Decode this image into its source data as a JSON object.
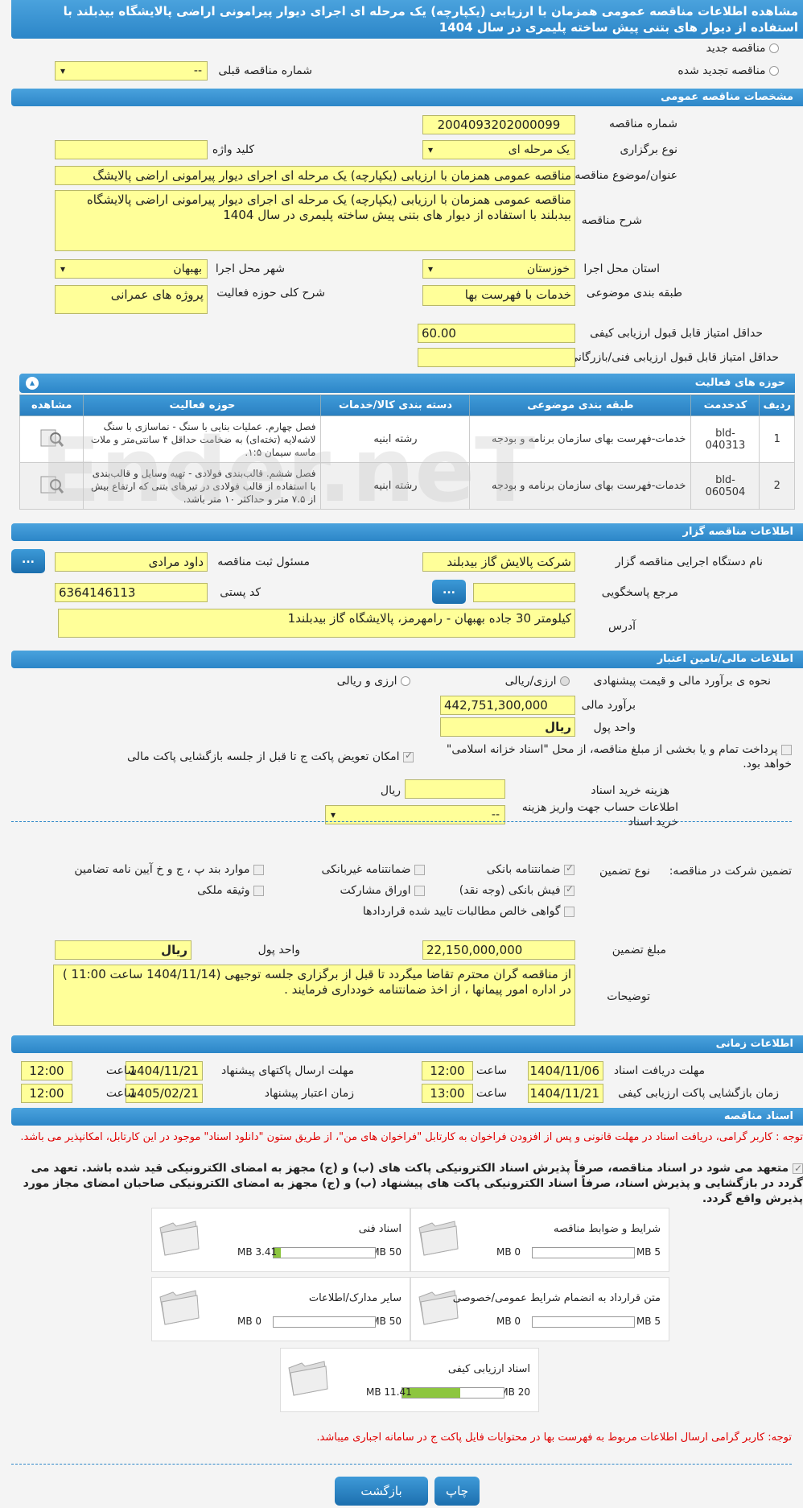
{
  "page": {
    "title": "مشاهده اطلاعات مناقصه عمومی همزمان با ارزیابی (یکپارچه) یک مرحله ای اجرای دیوار پیرامونی اراضی پالایشگاه بیدبلند با استفاده از دیوار های بتنی پیش ساخته پلیمری در سال 1404"
  },
  "top": {
    "new_tender": "مناقصه جدید",
    "renewed_tender": "مناقصه تجدید شده",
    "prev_number_label": "شماره مناقصه قبلی",
    "prev_number_value": "--"
  },
  "general": {
    "header": "مشخصات مناقصه عمومی",
    "number_label": "شماره مناقصه",
    "number_value": "2004093202000099",
    "type_label": "نوع برگزاری",
    "type_value": "یک مرحله ای",
    "keyword_label": "کلید واژه",
    "keyword_value": "",
    "subject_label": "عنوان/موضوع مناقصه",
    "subject_value": "مناقصه عمومی همزمان با ارزیابی (یکپارچه) یک مرحله ای اجرای دیوار پیرامونی اراضی پالایشگ",
    "desc_label": "شرح مناقصه",
    "desc_value": "مناقصه عمومی همزمان با ارزیابی (یکپارچه) یک مرحله ای اجرای دیوار پیرامونی اراضی پالایشگاه بیدبلند با استفاده از دیوار های بتنی پیش ساخته پلیمری در سال 1404",
    "province_label": "استان محل اجرا",
    "province_value": "خوزستان",
    "city_label": "شهر محل اجرا",
    "city_value": "بهبهان",
    "category_label": "طبقه بندی موضوعی",
    "category_value": "خدمات با فهرست بها",
    "scope_label": "شرح کلی حوزه فعالیت",
    "scope_value": "پروژه های عمرانی",
    "min_quality_label": "حداقل امتیاز قابل قبول ارزیابی کیفی",
    "min_quality_value": "60.00",
    "min_tech_label": "حداقل امتیاز قابل قبول ارزیابی فنی/بازرگانی",
    "min_tech_value": ""
  },
  "activities": {
    "header": "حوزه های فعالیت",
    "columns": [
      "ردیف",
      "کدخدمت",
      "طبقه بندی موضوعی",
      "دسته بندی کالا/خدمات",
      "حوزه فعالیت",
      "مشاهده"
    ],
    "rows": [
      {
        "row": "1",
        "code": "bld-040313",
        "category": "خدمات-فهرست بهای سازمان برنامه و بودجه",
        "group": "رشته ابنیه",
        "scope": "فصل چهارم. عملیات بنایی با سنگ - نماسازی با سنگ لاشه‌لایه (تخته‌ای) به ضخامت حداقل ۴ سانتی‌متر و ملات ماسه سیمان ۱:۵."
      },
      {
        "row": "2",
        "code": "bld-060504",
        "category": "خدمات-فهرست بهای سازمان برنامه و بودجه",
        "group": "رشته ابنیه",
        "scope": "فصل ششم. قالب‌بندی فولادی - تهیه وسایل و قالب‌بندی با استفاده از قالب فولادی در تیرهای بتنی که ارتفاع بیش از ۷.۵ متر و حداکثر ۱۰ متر باشد."
      }
    ]
  },
  "organizer": {
    "header": "اطلاعات مناقصه گزار",
    "org_label": "نام دستگاه اجرایی مناقصه گزار",
    "org_value": "شرکت پالایش گاز بیدبلند",
    "resp_label": "مسئول ثبت مناقصه",
    "resp_value": "داود مرادی",
    "ref_label": "مرجع پاسخگویی",
    "ref_value": "",
    "postal_label": "کد پستی",
    "postal_value": "6364146113",
    "address_label": "آدرس",
    "address_value": "کیلومتر 30 جاده بهبهان - رامهرمز، پالایشگاه گاز بیدبلند1",
    "more_btn": "..."
  },
  "finance": {
    "header": "اطلاعات مالی/تامین اعتبار",
    "estimate_method_label": "نحوه ی برآورد مالی و قیمت پیشنهادی",
    "opt_rial_fx": "ارزی/ریالی",
    "opt_fx_and_rial": "ارزی و ریالی",
    "estimate_label": "برآورد مالی",
    "estimate_value": "442,751,300,000",
    "currency_label": "واحد پول",
    "currency_value": "ریال",
    "treasury_text": "پرداخت تمام و یا بخشی از مبلغ مناقصه، از محل \"اسناد خزانه اسلامی\" خواهد بود.",
    "swap_text": "امکان تعویض پاکت ج تا قبل از جلسه بازگشایی پاکت مالی",
    "doc_fee_label": "هزینه خرید اسناد",
    "doc_fee_unit": "ریال",
    "account_label": "اطلاعات حساب جهت واریز هزینه خرید اسناد",
    "account_value": "--"
  },
  "guarantee": {
    "label": "تضمین شرکت در مناقصه:",
    "type_label": "نوع تضمین",
    "opt_bank_guarantee": "ضمانتنامه بانکی",
    "opt_nonbank_guarantee": "ضمانتنامه غیربانکی",
    "opt_clauses": "موارد بند پ ، ج و خ آیین نامه تضامین",
    "opt_bank_receipt": "فیش بانکی (وجه نقد)",
    "opt_bonds": "اوراق مشارکت",
    "opt_property": "وثیقه ملکی",
    "opt_receivables": "گواهی خالص مطالبات تایید شده قراردادها",
    "amount_label": "مبلغ تضمین",
    "amount_value": "22,150,000,000",
    "unit_label": "واحد پول",
    "unit_value": "ریال",
    "notes_label": "توضیحات",
    "notes_value": "از مناقصه گران محترم تقاضا میگردد تا قبل از برگزاری جلسه توجیهی (1404/11/14 ساعت 11:00 ) در اداره امور پیمانها ، از اخذ ضمانتنامه خودداری فرمایند ."
  },
  "timing": {
    "header": "اطلاعات زمانی",
    "receive_docs_label": "مهلت دریافت اسناد",
    "receive_docs_date": "1404/11/06",
    "receive_docs_time": "12:00",
    "send_bids_label": "مهلت ارسال پاکتهای پیشنهاد",
    "send_bids_date": "1404/11/21",
    "send_bids_time": "12:00",
    "open_quality_label": "زمان بازگشایی پاکت ارزیابی کیفی",
    "open_quality_date": "1404/11/21",
    "open_quality_time": "13:00",
    "validity_label": "زمان اعتبار پیشنهاد",
    "validity_date": "1405/02/21",
    "validity_time": "12:00",
    "time_label": "ساعت"
  },
  "documents": {
    "header": "اسناد مناقصه",
    "notice": "توجه : کاربر گرامی، دریافت اسناد در مهلت قانونی و پس از افزودن فراخوان به کارتابل \"فراخوان های من\"، از طریق ستون \"دانلود اسناد\" موجود در این کارتابل، امکانپذیر می باشد.",
    "commitment": "متعهد می شود در اسناد مناقصه، صرفاً پذیرش اسناد الکترونیکی پاکت های (ب) و (ج) مجهز به امضای الکترونیکی قید شده باشد. تعهد می گردد در بازگشایی و پذیرش اسناد، صرفاً اسناد الکترونیکی پاکت های پیشنهاد (ب) و (ج) مجهز به امضای الکترونیکی صاحبان امضای مجاز مورد پذیرش واقع گردد.",
    "cards": [
      {
        "title": "شرایط و ضوابط مناقصه",
        "current": "0 MB",
        "max": "5 MB",
        "fill": 0
      },
      {
        "title": "اسناد فنی",
        "current": "3.41 MB",
        "max": "50 MB",
        "fill": 0.07
      },
      {
        "title": "متن قرارداد به انضمام شرایط عمومی/خصوصی",
        "current": "0 MB",
        "max": "5 MB",
        "fill": 0
      },
      {
        "title": "سایر مدارک/اطلاعات",
        "current": "0 MB",
        "max": "50 MB",
        "fill": 0
      },
      {
        "title": "اسناد ارزیابی کیفی",
        "current": "11.41 MB",
        "max": "20 MB",
        "fill": 0.57
      }
    ],
    "footer_note": "توجه: کاربر گرامی ارسال اطلاعات مربوط به فهرست بها در محتوایات فایل پاکت ج در سامانه اجباری میباشد."
  },
  "actions": {
    "print": "چاپ",
    "back": "بازگشت"
  },
  "watermark": "Ender.neT"
}
